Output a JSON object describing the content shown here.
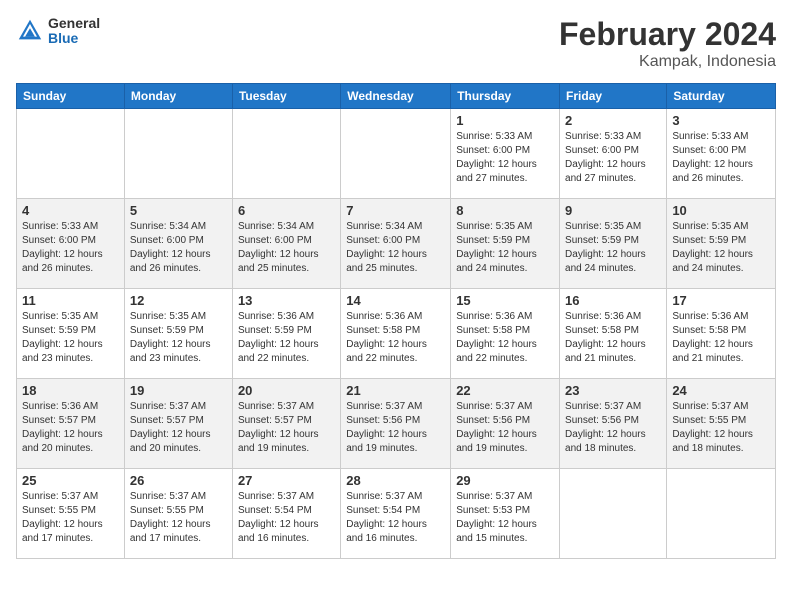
{
  "header": {
    "logo_general": "General",
    "logo_blue": "Blue",
    "month_title": "February 2024",
    "location": "Kampak, Indonesia"
  },
  "days_of_week": [
    "Sunday",
    "Monday",
    "Tuesday",
    "Wednesday",
    "Thursday",
    "Friday",
    "Saturday"
  ],
  "weeks": [
    [
      {
        "day": "",
        "info": ""
      },
      {
        "day": "",
        "info": ""
      },
      {
        "day": "",
        "info": ""
      },
      {
        "day": "",
        "info": ""
      },
      {
        "day": "1",
        "info": "Sunrise: 5:33 AM\nSunset: 6:00 PM\nDaylight: 12 hours and 27 minutes."
      },
      {
        "day": "2",
        "info": "Sunrise: 5:33 AM\nSunset: 6:00 PM\nDaylight: 12 hours and 27 minutes."
      },
      {
        "day": "3",
        "info": "Sunrise: 5:33 AM\nSunset: 6:00 PM\nDaylight: 12 hours and 26 minutes."
      }
    ],
    [
      {
        "day": "4",
        "info": "Sunrise: 5:33 AM\nSunset: 6:00 PM\nDaylight: 12 hours and 26 minutes."
      },
      {
        "day": "5",
        "info": "Sunrise: 5:34 AM\nSunset: 6:00 PM\nDaylight: 12 hours and 26 minutes."
      },
      {
        "day": "6",
        "info": "Sunrise: 5:34 AM\nSunset: 6:00 PM\nDaylight: 12 hours and 25 minutes."
      },
      {
        "day": "7",
        "info": "Sunrise: 5:34 AM\nSunset: 6:00 PM\nDaylight: 12 hours and 25 minutes."
      },
      {
        "day": "8",
        "info": "Sunrise: 5:35 AM\nSunset: 5:59 PM\nDaylight: 12 hours and 24 minutes."
      },
      {
        "day": "9",
        "info": "Sunrise: 5:35 AM\nSunset: 5:59 PM\nDaylight: 12 hours and 24 minutes."
      },
      {
        "day": "10",
        "info": "Sunrise: 5:35 AM\nSunset: 5:59 PM\nDaylight: 12 hours and 24 minutes."
      }
    ],
    [
      {
        "day": "11",
        "info": "Sunrise: 5:35 AM\nSunset: 5:59 PM\nDaylight: 12 hours and 23 minutes."
      },
      {
        "day": "12",
        "info": "Sunrise: 5:35 AM\nSunset: 5:59 PM\nDaylight: 12 hours and 23 minutes."
      },
      {
        "day": "13",
        "info": "Sunrise: 5:36 AM\nSunset: 5:59 PM\nDaylight: 12 hours and 22 minutes."
      },
      {
        "day": "14",
        "info": "Sunrise: 5:36 AM\nSunset: 5:58 PM\nDaylight: 12 hours and 22 minutes."
      },
      {
        "day": "15",
        "info": "Sunrise: 5:36 AM\nSunset: 5:58 PM\nDaylight: 12 hours and 22 minutes."
      },
      {
        "day": "16",
        "info": "Sunrise: 5:36 AM\nSunset: 5:58 PM\nDaylight: 12 hours and 21 minutes."
      },
      {
        "day": "17",
        "info": "Sunrise: 5:36 AM\nSunset: 5:58 PM\nDaylight: 12 hours and 21 minutes."
      }
    ],
    [
      {
        "day": "18",
        "info": "Sunrise: 5:36 AM\nSunset: 5:57 PM\nDaylight: 12 hours and 20 minutes."
      },
      {
        "day": "19",
        "info": "Sunrise: 5:37 AM\nSunset: 5:57 PM\nDaylight: 12 hours and 20 minutes."
      },
      {
        "day": "20",
        "info": "Sunrise: 5:37 AM\nSunset: 5:57 PM\nDaylight: 12 hours and 19 minutes."
      },
      {
        "day": "21",
        "info": "Sunrise: 5:37 AM\nSunset: 5:56 PM\nDaylight: 12 hours and 19 minutes."
      },
      {
        "day": "22",
        "info": "Sunrise: 5:37 AM\nSunset: 5:56 PM\nDaylight: 12 hours and 19 minutes."
      },
      {
        "day": "23",
        "info": "Sunrise: 5:37 AM\nSunset: 5:56 PM\nDaylight: 12 hours and 18 minutes."
      },
      {
        "day": "24",
        "info": "Sunrise: 5:37 AM\nSunset: 5:55 PM\nDaylight: 12 hours and 18 minutes."
      }
    ],
    [
      {
        "day": "25",
        "info": "Sunrise: 5:37 AM\nSunset: 5:55 PM\nDaylight: 12 hours and 17 minutes."
      },
      {
        "day": "26",
        "info": "Sunrise: 5:37 AM\nSunset: 5:55 PM\nDaylight: 12 hours and 17 minutes."
      },
      {
        "day": "27",
        "info": "Sunrise: 5:37 AM\nSunset: 5:54 PM\nDaylight: 12 hours and 16 minutes."
      },
      {
        "day": "28",
        "info": "Sunrise: 5:37 AM\nSunset: 5:54 PM\nDaylight: 12 hours and 16 minutes."
      },
      {
        "day": "29",
        "info": "Sunrise: 5:37 AM\nSunset: 5:53 PM\nDaylight: 12 hours and 15 minutes."
      },
      {
        "day": "",
        "info": ""
      },
      {
        "day": "",
        "info": ""
      }
    ]
  ]
}
